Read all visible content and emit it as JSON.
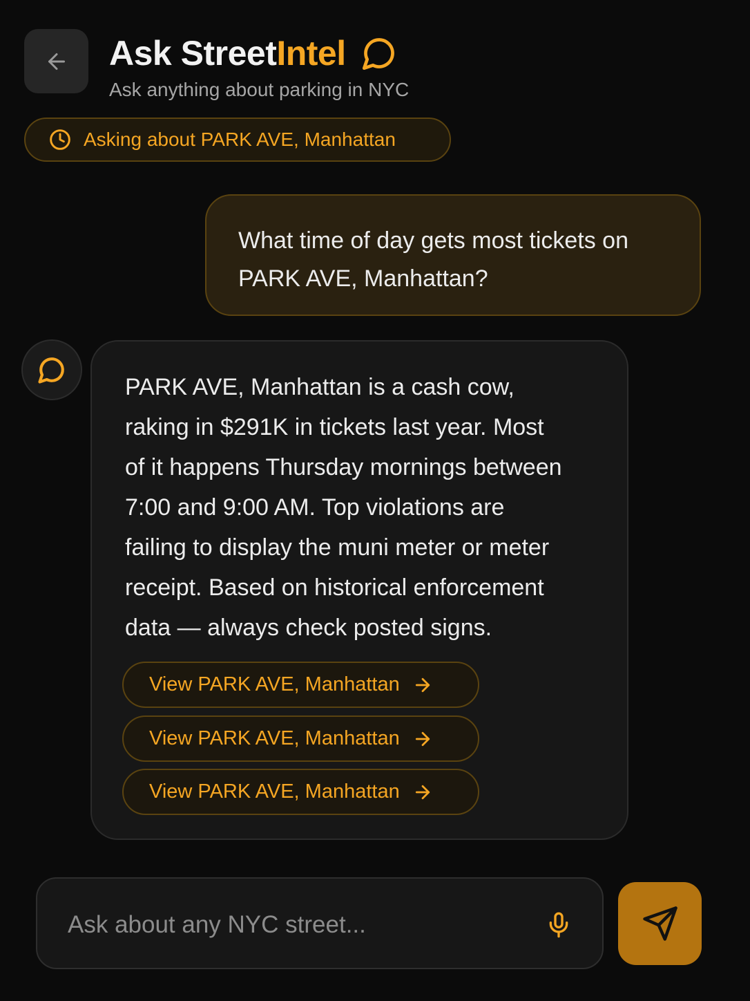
{
  "header": {
    "title_main": "Ask Street",
    "title_accent": "Intel",
    "subtitle": "Ask anything about parking in NYC",
    "back_icon": "arrow-left-icon",
    "title_icon": "chat-bubble-icon"
  },
  "context": {
    "label": "Asking about PARK AVE, Manhattan",
    "icon": "clock-icon"
  },
  "messages": {
    "user": {
      "text": "What time of day gets most tickets on PARK AVE, Manhattan?"
    },
    "assistant": {
      "avatar_icon": "chat-bubble-icon",
      "lines": [
        "PARK AVE, Manhattan is a cash cow,",
        "raking in $291K in tickets last year. Most",
        "of it happens Thursday mornings between",
        "7:00 and 9:00 AM. Top violations are",
        "failing to display the muni meter or meter",
        "receipt. Based on historical enforcement",
        "data — always check posted signs."
      ],
      "actions": [
        {
          "label": "View PARK AVE, Manhattan",
          "icon": "arrow-right-icon"
        },
        {
          "label": "View PARK AVE, Manhattan",
          "icon": "arrow-right-icon"
        },
        {
          "label": "View PARK AVE, Manhattan",
          "icon": "arrow-right-icon"
        }
      ]
    }
  },
  "composer": {
    "value": "",
    "placeholder": "Ask about any NYC street...",
    "mic_icon": "microphone-icon",
    "send_icon": "send-icon"
  },
  "colors": {
    "background": "#0b0b0b",
    "accent": "#f5a623",
    "send_button": "#b47410",
    "user_bubble": "#2a2110",
    "assistant_bubble": "#171717"
  }
}
